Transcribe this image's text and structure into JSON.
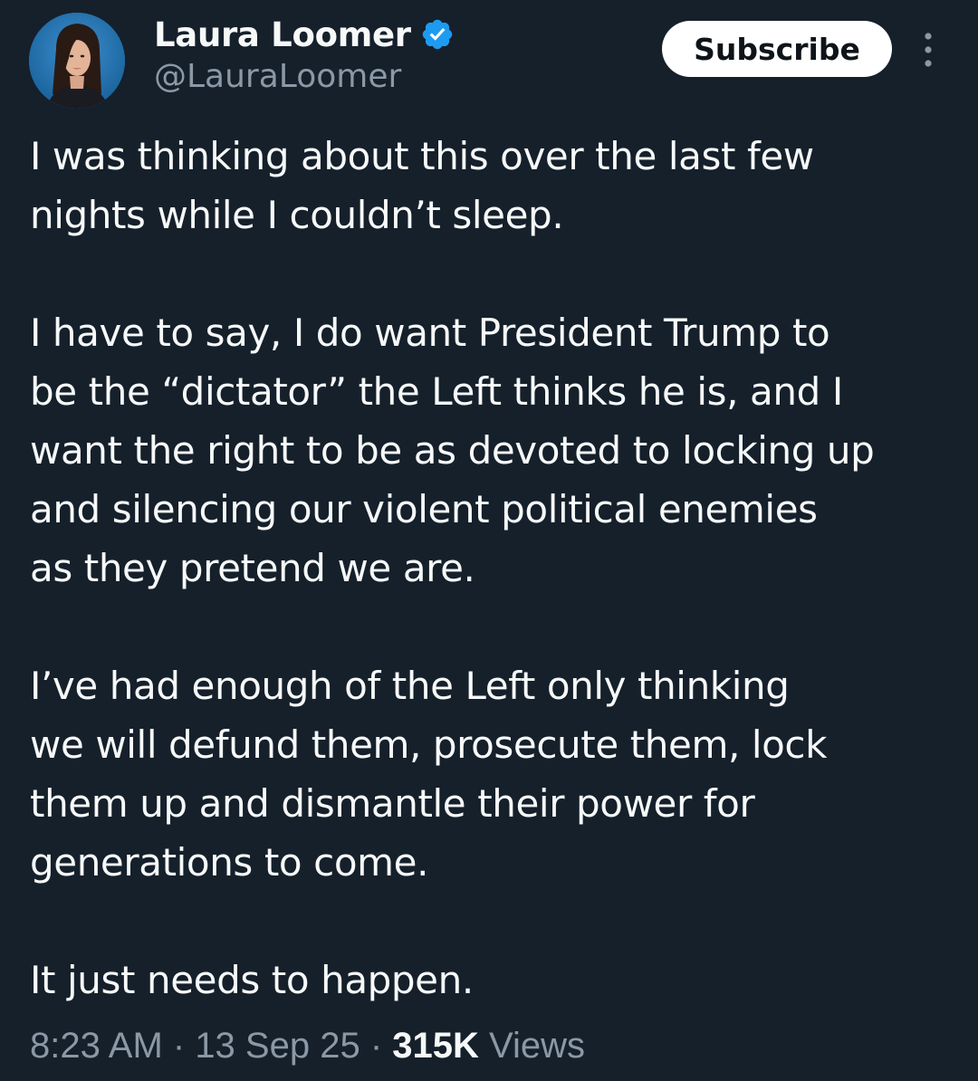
{
  "author": {
    "display_name": "Laura Loomer",
    "handle": "@LauraLoomer",
    "verified": true
  },
  "actions": {
    "subscribe_label": "Subscribe"
  },
  "tweet": {
    "paragraphs": [
      "I was thinking about this over the last few\nnights while I couldn’t sleep.",
      "I have to say, I do want President Trump to\nbe the “dictator” the Left thinks he is, and I\nwant the right to be as devoted to locking up\nand silencing our violent political enemies\nas they pretend we are.",
      "I’ve had enough of the Left only thinking\nwe will defund them, prosecute them, lock\nthem up and dismantle their power for\ngenerations to come.",
      "It just needs to happen."
    ]
  },
  "meta": {
    "time": "8:23 AM",
    "separator": " · ",
    "date": "13 Sep 25",
    "views_count": "315K",
    "views_label": " Views"
  },
  "colors": {
    "background": "#15202b",
    "text_primary": "#f7f9f9",
    "text_secondary": "#8b98a5",
    "verified_badge": "#1d9bf0",
    "subscribe_bg": "#ffffff"
  },
  "icons": {
    "verified": "verified-badge-icon",
    "more": "more-vertical-icon"
  }
}
